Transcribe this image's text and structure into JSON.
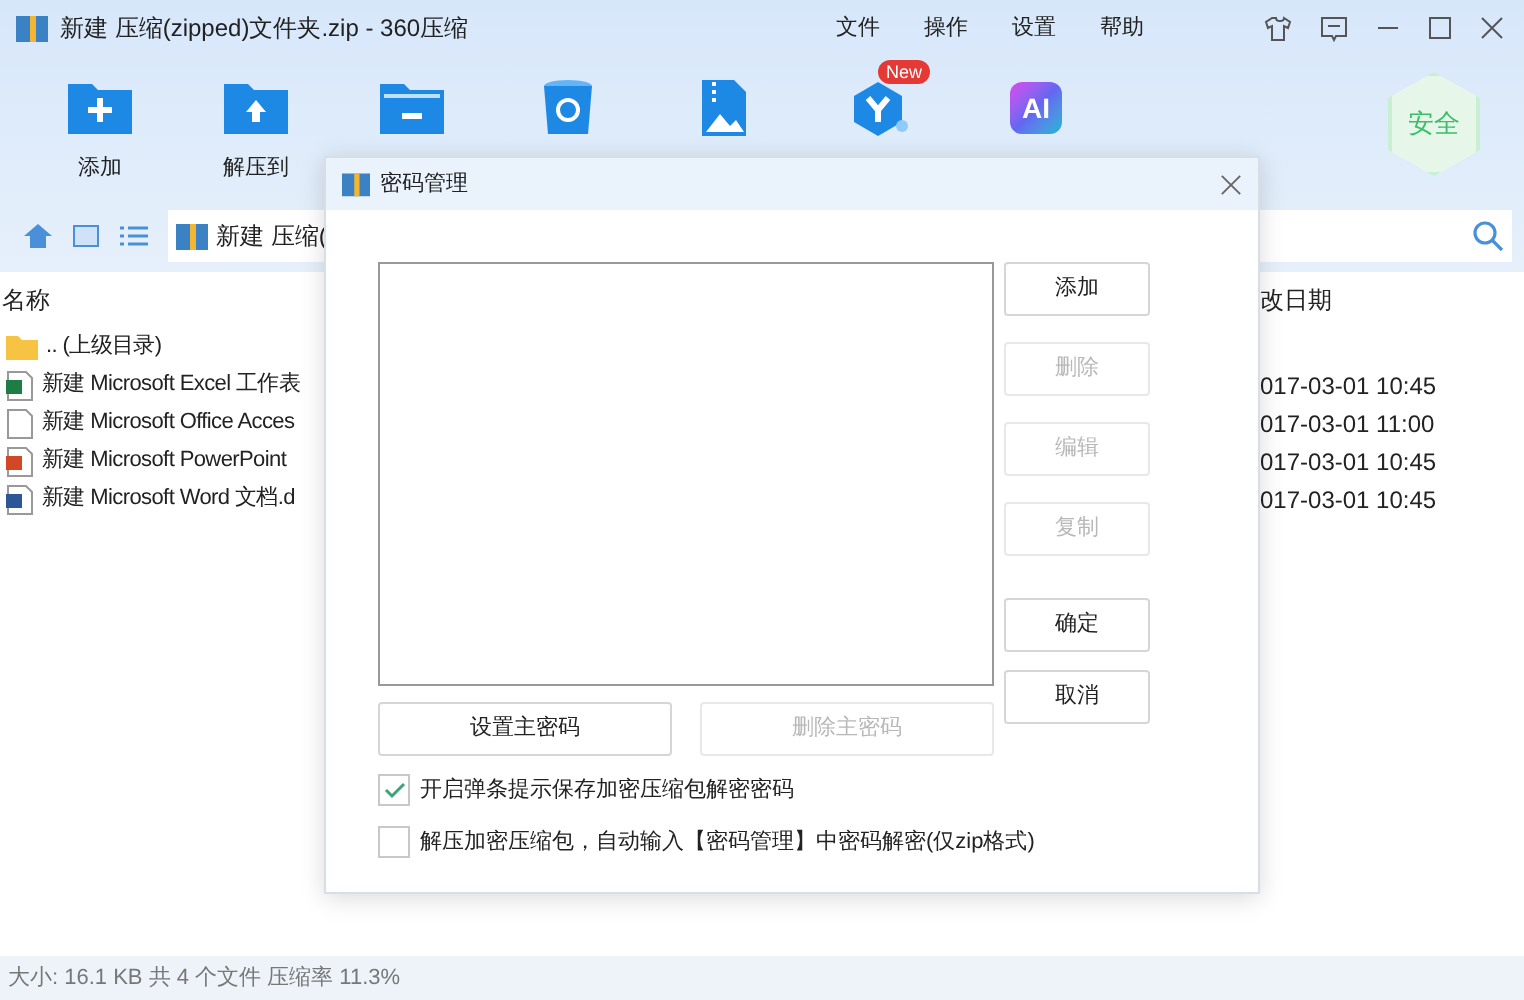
{
  "window": {
    "title": "新建 压缩(zipped)文件夹.zip - 360压缩"
  },
  "menu": [
    "文件",
    "操作",
    "设置",
    "帮助"
  ],
  "toolbar": [
    {
      "kind": "add",
      "label": "添加"
    },
    {
      "kind": "extract",
      "label": "解压到"
    },
    {
      "kind": "folder-minus"
    },
    {
      "kind": "recycle"
    },
    {
      "kind": "image-zip"
    },
    {
      "kind": "hex",
      "badge": "New"
    },
    {
      "kind": "ai",
      "glyph": "AI"
    }
  ],
  "security_badge": "安全",
  "address": {
    "value": "新建 压缩("
  },
  "table": {
    "columns": [
      "名称",
      "改日期"
    ],
    "rows": [
      {
        "kind": "folder",
        "name": ".. (上级目录)"
      },
      {
        "kind": "excel",
        "name": "新建 Microsoft Excel 工作表",
        "date": "017-03-01 10:45"
      },
      {
        "kind": "blank",
        "name": "新建 Microsoft Office Acces",
        "date": "017-03-01 11:00"
      },
      {
        "kind": "ppt",
        "name": "新建 Microsoft PowerPoint",
        "date": "017-03-01 10:45"
      },
      {
        "kind": "word",
        "name": "新建 Microsoft Word 文档.d",
        "date": "017-03-01 10:45"
      }
    ]
  },
  "dialog": {
    "title": "密码管理",
    "side_buttons": [
      {
        "label": "添加",
        "disabled": false
      },
      {
        "label": "删除",
        "disabled": true
      },
      {
        "label": "编辑",
        "disabled": true
      },
      {
        "label": "复制",
        "disabled": true
      }
    ],
    "confirm_buttons": [
      {
        "label": "确定",
        "disabled": false
      },
      {
        "label": "取消",
        "disabled": false
      }
    ],
    "bottom_buttons": [
      {
        "label": "设置主密码",
        "disabled": false
      },
      {
        "label": "删除主密码",
        "disabled": true
      }
    ],
    "options": [
      {
        "label": "开启弹条提示保存加密压缩包解密密码",
        "checked": true
      },
      {
        "label": "解压加密压缩包，自动输入【密码管理】中密码解密(仅zip格式)",
        "checked": false
      }
    ]
  },
  "status_bar": "大小: 16.1 KB 共 4 个文件 压缩率 11.3%"
}
